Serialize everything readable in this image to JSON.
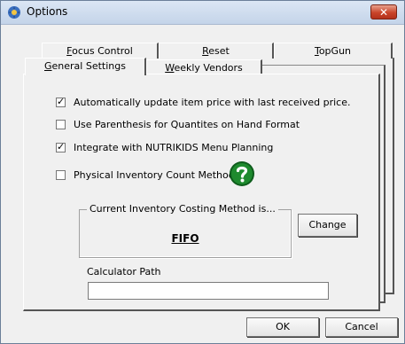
{
  "window": {
    "title": "Options",
    "close_label": "✕"
  },
  "tabs": {
    "back_row": [
      {
        "label": "Focus Control",
        "hotkey_index": 0
      },
      {
        "label": "Reset",
        "hotkey_index": 0
      },
      {
        "label": "TopGun",
        "hotkey_index": 0
      }
    ],
    "front_row": [
      {
        "label": "General Settings",
        "hotkey_index": 0,
        "active": true
      },
      {
        "label": "Weekly Vendors",
        "hotkey_index": 0,
        "active": false
      }
    ]
  },
  "options": [
    {
      "label": "Automatically update item price with last received price.",
      "checked": true
    },
    {
      "label": "Use Parenthesis for Quantites on Hand Format",
      "checked": false
    },
    {
      "label": "Integrate with NUTRIKIDS Menu Planning",
      "checked": true
    },
    {
      "label": "Physical Inventory Count Method",
      "checked": false
    }
  ],
  "costing": {
    "legend": "Current Inventory Costing Method is...",
    "method": "FIFO",
    "change_label": "Change"
  },
  "calculator": {
    "label": "Calculator Path",
    "value": ""
  },
  "footer": {
    "ok_label": "OK",
    "cancel_label": "Cancel"
  },
  "colors": {
    "help_icon": "#1e8a2e",
    "close_button": "#c9452a"
  }
}
